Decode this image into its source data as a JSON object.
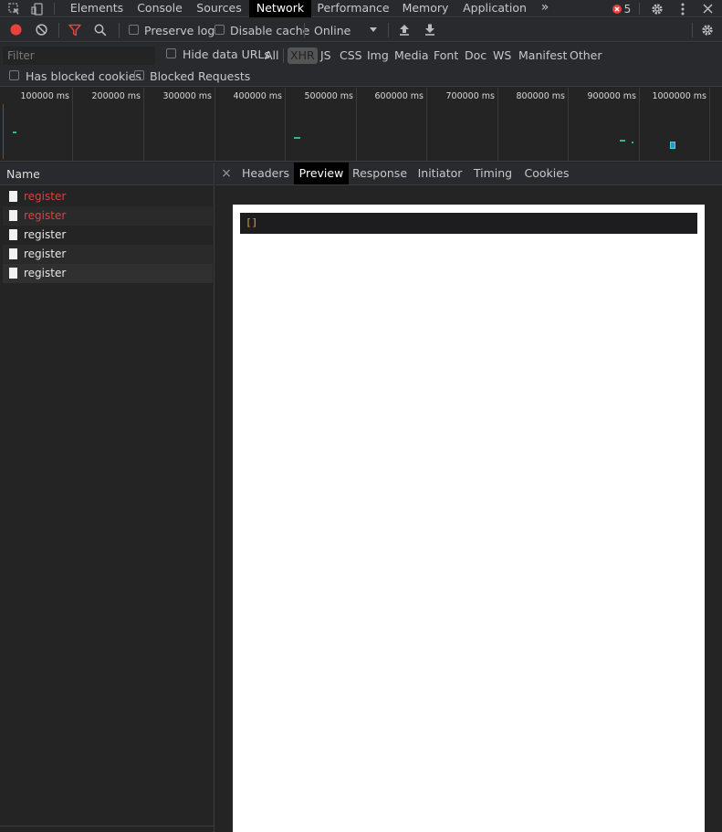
{
  "tabbar": {
    "tabs": [
      "Elements",
      "Console",
      "Sources",
      "Network",
      "Performance",
      "Memory",
      "Application"
    ],
    "active_tab": "Network",
    "more_glyph": "»",
    "error_count": "5"
  },
  "toolbar": {
    "preserve_log": "Preserve log",
    "disable_cache": "Disable cache",
    "throttling": "Online"
  },
  "filter": {
    "placeholder": "Filter",
    "hide_data_urls": "Hide data URLs",
    "types": [
      "All",
      "XHR",
      "JS",
      "CSS",
      "Img",
      "Media",
      "Font",
      "Doc",
      "WS",
      "Manifest",
      "Other"
    ],
    "active_type": "XHR",
    "has_blocked_cookies": "Has blocked cookies",
    "blocked_requests": "Blocked Requests"
  },
  "overview": {
    "ticks": [
      "100000 ms",
      "200000 ms",
      "300000 ms",
      "400000 ms",
      "500000 ms",
      "600000 ms",
      "700000 ms",
      "800000 ms",
      "900000 ms",
      "1000000 ms"
    ]
  },
  "requests": {
    "column_header": "Name",
    "rows": [
      {
        "name": "register",
        "status": "error"
      },
      {
        "name": "register",
        "status": "error"
      },
      {
        "name": "register",
        "status": "ok"
      },
      {
        "name": "register",
        "status": "ok"
      },
      {
        "name": "register",
        "status": "ok"
      }
    ]
  },
  "detail": {
    "close_glyph": "×",
    "tabs": [
      "Headers",
      "Preview",
      "Response",
      "Initiator",
      "Timing",
      "Cookies"
    ],
    "active_tab": "Preview",
    "preview_text": "[]"
  },
  "colors": {
    "record": "#e8433a",
    "filter_active": "#e8433a",
    "error_text": "#e33e3e",
    "bar": "#2bb592",
    "json_bracket": "#f29d38"
  }
}
